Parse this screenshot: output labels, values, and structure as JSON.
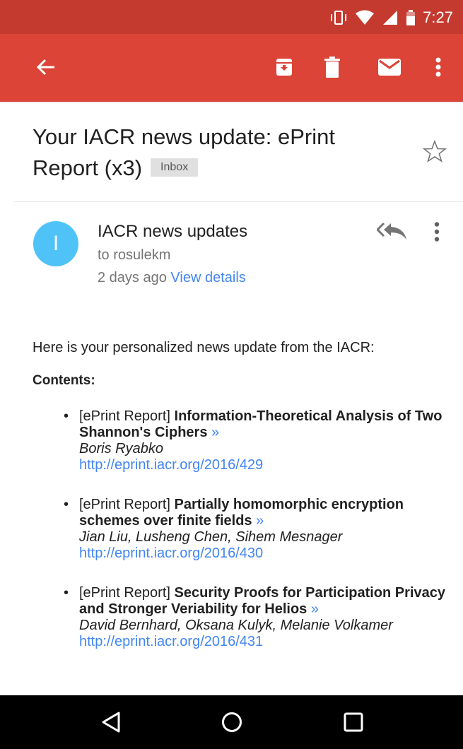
{
  "status_bar": {
    "time": "7:27",
    "icons": [
      "vibrate-icon",
      "wifi-icon",
      "signal-icon",
      "battery-icon"
    ]
  },
  "app_bar": {
    "back_icon": "arrow-back-icon",
    "actions": [
      "archive-icon",
      "delete-icon",
      "mark-unread-icon",
      "more-vert-icon"
    ]
  },
  "email": {
    "subject": "Your IACR news update: ePrint Report (x3)",
    "label": "Inbox",
    "starred": false,
    "sender": {
      "avatar_letter": "I",
      "name": "IACR news updates",
      "to": "to rosulekm",
      "time": "2 days ago",
      "details_link": "View details"
    },
    "body": {
      "intro": "Here is your personalized news update from the IACR:",
      "contents_label": "Contents:",
      "items": [
        {
          "prefix": "[ePrint Report]",
          "title": "Information-Theoretical Analysis of Two Shannon's Ciphers",
          "arrow": "»",
          "authors": "Boris Ryabko",
          "url": "http://eprint.iacr.org/2016/429"
        },
        {
          "prefix": "[ePrint Report]",
          "title": "Partially homomorphic encryption schemes over finite fields",
          "arrow": "»",
          "authors": "Jian Liu, Lusheng Chen, Sihem Mesnager",
          "url": "http://eprint.iacr.org/2016/430"
        },
        {
          "prefix": "[ePrint Report]",
          "title": "Security Proofs for Participation Privacy and Stronger Veriability for Helios",
          "arrow": "»",
          "authors": "David Bernhard, Oksana Kulyk, Melanie Volkamer",
          "url": "http://eprint.iacr.org/2016/431"
        }
      ]
    }
  },
  "nav_bar": {
    "buttons": [
      "back-triangle-icon",
      "home-circle-icon",
      "recents-square-icon"
    ]
  },
  "colors": {
    "status_bar": "#c53a2f",
    "app_bar": "#db4437",
    "avatar": "#4fc3f7",
    "link": "#4285f4"
  }
}
